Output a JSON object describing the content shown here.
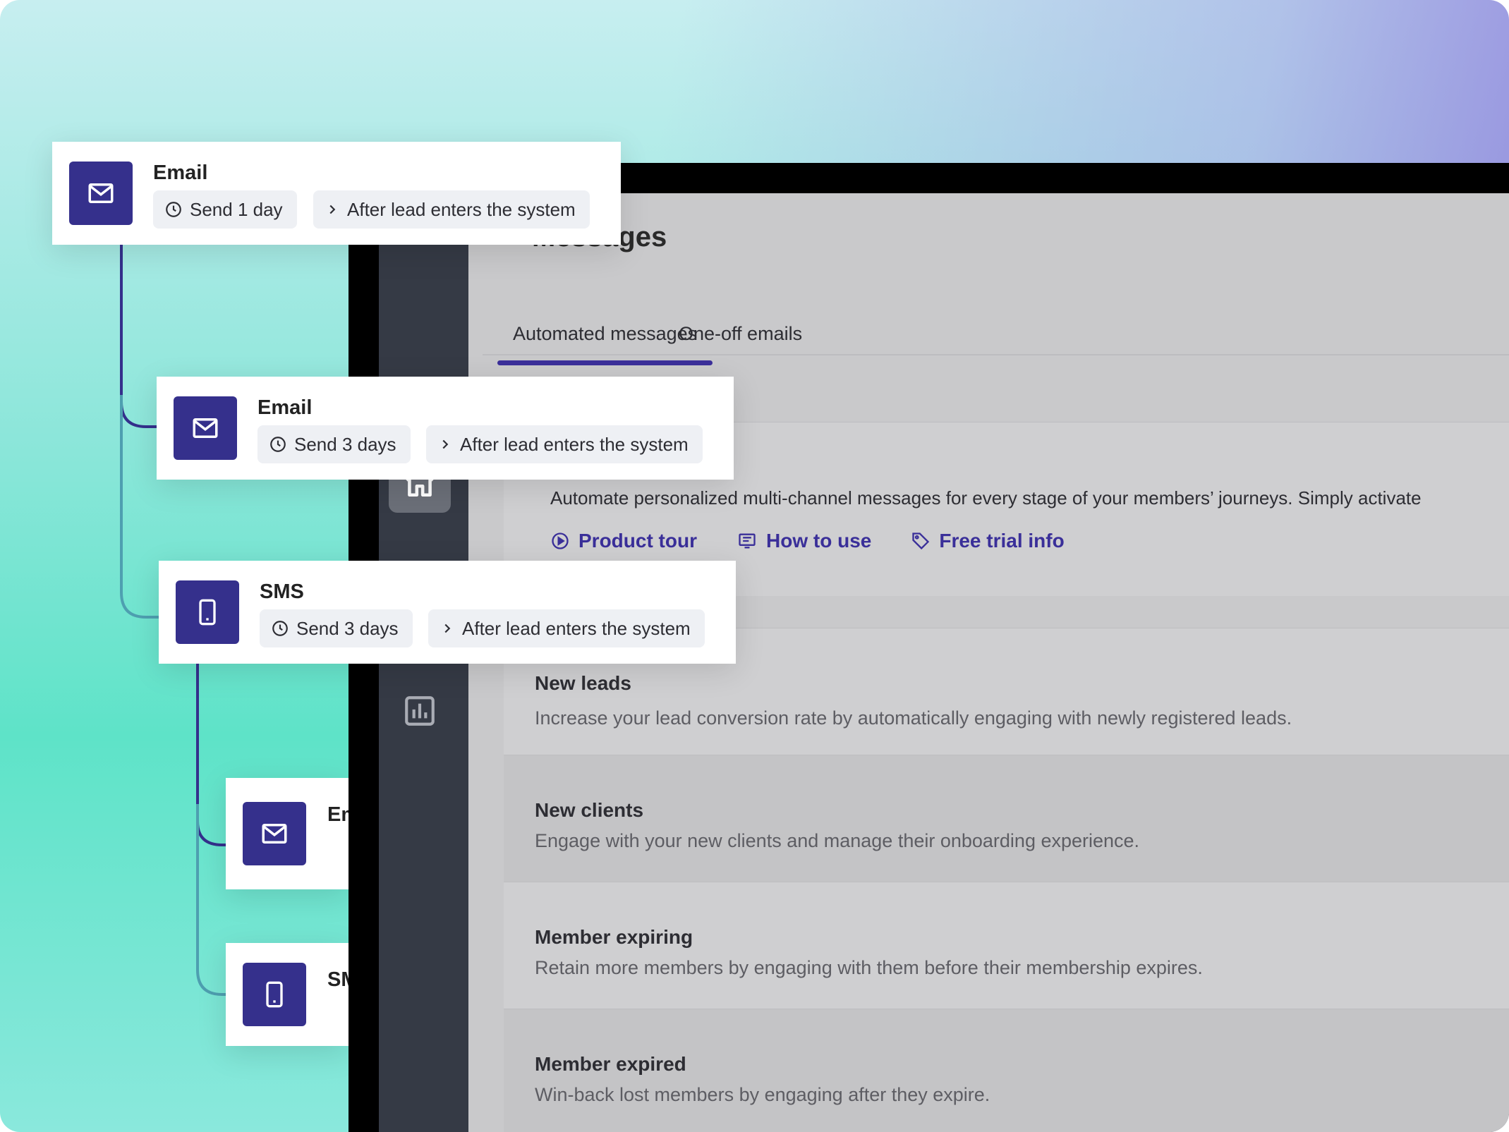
{
  "app": {
    "page_title": "Messages",
    "tabs": [
      {
        "label": "Automated messages",
        "active": true
      },
      {
        "label": "One-off emails",
        "active": false
      }
    ],
    "intro": {
      "text": "Automate personalized multi-channel messages for every stage of your members’ journeys. Simply activate",
      "links": [
        {
          "label": "Product tour",
          "icon": "play-circle-icon"
        },
        {
          "label": "How to use",
          "icon": "guide-icon"
        },
        {
          "label": "Free trial info",
          "icon": "tag-icon"
        }
      ]
    },
    "journeys": [
      {
        "title": "New leads",
        "description": "Increase your lead conversion rate by automatically engaging with newly registered leads."
      },
      {
        "title": "New clients",
        "description": "Engage with your new clients and manage their onboarding experience."
      },
      {
        "title": "Member expiring",
        "description": "Retain more members by engaging with them before their membership expires."
      },
      {
        "title": "Member expired",
        "description": "Win-back lost members by engaging after they expire."
      }
    ],
    "nav": [
      "home-icon",
      "chat-icon",
      "reports-icon"
    ]
  },
  "flow_cards": [
    {
      "type": "Email",
      "icon": "mail-icon",
      "delay": "Send 1 day",
      "trigger": "After lead enters the system"
    },
    {
      "type": "Email",
      "icon": "mail-icon",
      "delay": "Send 3 days",
      "trigger": "After lead enters the system"
    },
    {
      "type": "SMS",
      "icon": "phone-icon",
      "delay": "Send 3 days",
      "trigger": "After lead enters the system"
    },
    {
      "type": "Email",
      "icon": "mail-icon"
    },
    {
      "type": "SMS",
      "icon": "phone-icon"
    }
  ],
  "colors": {
    "brand_purple": "#35308c",
    "link_purple": "#3a2f99",
    "nav_dark": "#353a45",
    "flow_line_dark": "#34308c",
    "flow_line_teal": "#4e9fb0"
  }
}
